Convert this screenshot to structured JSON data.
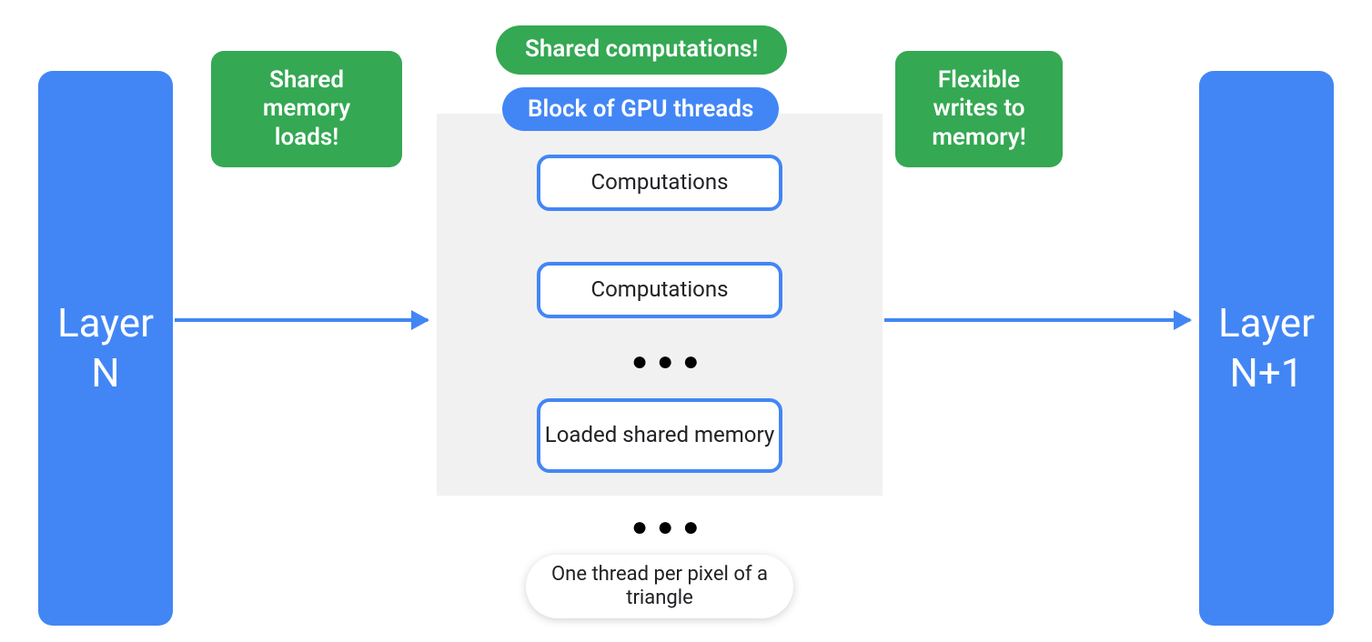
{
  "layers": {
    "left": "Layer\nN",
    "right": "Layer\nN+1"
  },
  "tags": {
    "shared_loads": "Shared memory loads!",
    "shared_comp": "Shared computations!",
    "flexible_writes": "Flexible writes to memory!"
  },
  "block": {
    "title": "Block of GPU threads",
    "item1": "Computations",
    "item2": "Computations",
    "item3": "Loaded shared memory",
    "caption": "One thread per pixel of a triangle"
  },
  "colors": {
    "blue": "#4286f5",
    "green": "#34a853",
    "grey": "#f1f1f1"
  }
}
